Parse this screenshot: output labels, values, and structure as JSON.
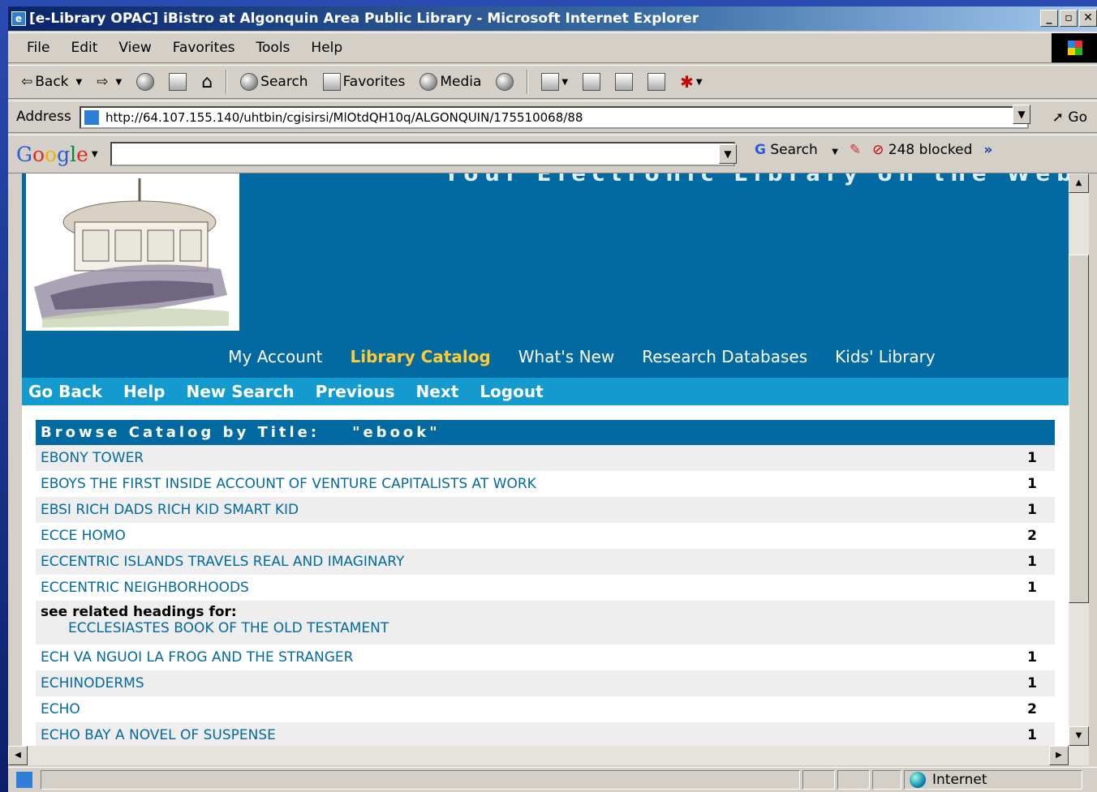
{
  "window": {
    "title": "[e-Library OPAC] iBistro at Algonquin Area Public Library - Microsoft Internet Explorer",
    "min_glyph": "_",
    "max_glyph": "▫",
    "close_glyph": "✕"
  },
  "menu": [
    "File",
    "Edit",
    "View",
    "Favorites",
    "Tools",
    "Help"
  ],
  "toolbar": {
    "back": "Back",
    "search": "Search",
    "favorites": "Favorites",
    "media": "Media"
  },
  "address": {
    "label": "Address",
    "url": "http://64.107.155.140/uhtbin/cgisirsi/MlOtdQH10q/ALGONQUIN/175510068/88",
    "go": "Go"
  },
  "google_bar": {
    "logo": "Google",
    "search": "Search",
    "blocked": "248 blocked",
    "more": "»"
  },
  "banner": {
    "title_fragment": "Your Electronic Library on the Web"
  },
  "nav": {
    "items": [
      "My Account",
      "Library Catalog",
      "What's New",
      "Research Databases",
      "Kids' Library"
    ],
    "active": "Library Catalog"
  },
  "actions": [
    "Go Back",
    "Help",
    "New Search",
    "Previous",
    "Next",
    "Logout"
  ],
  "browse": {
    "heading": "Browse Catalog by Title:",
    "query": "\"ebook\"",
    "rows_before": [
      {
        "title": "EBONY TOWER",
        "count": "1"
      },
      {
        "title": "EBOYS THE FIRST INSIDE ACCOUNT OF VENTURE CAPITALISTS AT WORK",
        "count": "1"
      },
      {
        "title": "EBSI RICH DADS RICH KID SMART KID",
        "count": "1"
      },
      {
        "title": "ECCE HOMO",
        "count": "2"
      },
      {
        "title": "ECCENTRIC ISLANDS TRAVELS REAL AND IMAGINARY",
        "count": "1"
      },
      {
        "title": "ECCENTRIC NEIGHBORHOODS",
        "count": "1"
      }
    ],
    "related_label": "see related headings for:",
    "related_link": "ECCLESIASTES BOOK OF THE OLD TESTAMENT",
    "rows_after": [
      {
        "title": "ECH VA NGUOI LA FROG AND THE STRANGER",
        "count": "1"
      },
      {
        "title": "ECHINODERMS",
        "count": "1"
      },
      {
        "title": "ECHO",
        "count": "2"
      },
      {
        "title": "ECHO BAY A NOVEL OF SUSPENSE",
        "count": "1"
      }
    ]
  },
  "status": {
    "zone": "Internet"
  },
  "colors": {
    "banner_blue": "#036aa1",
    "action_blue": "#139bd0",
    "active_nav": "#ffcc33"
  }
}
